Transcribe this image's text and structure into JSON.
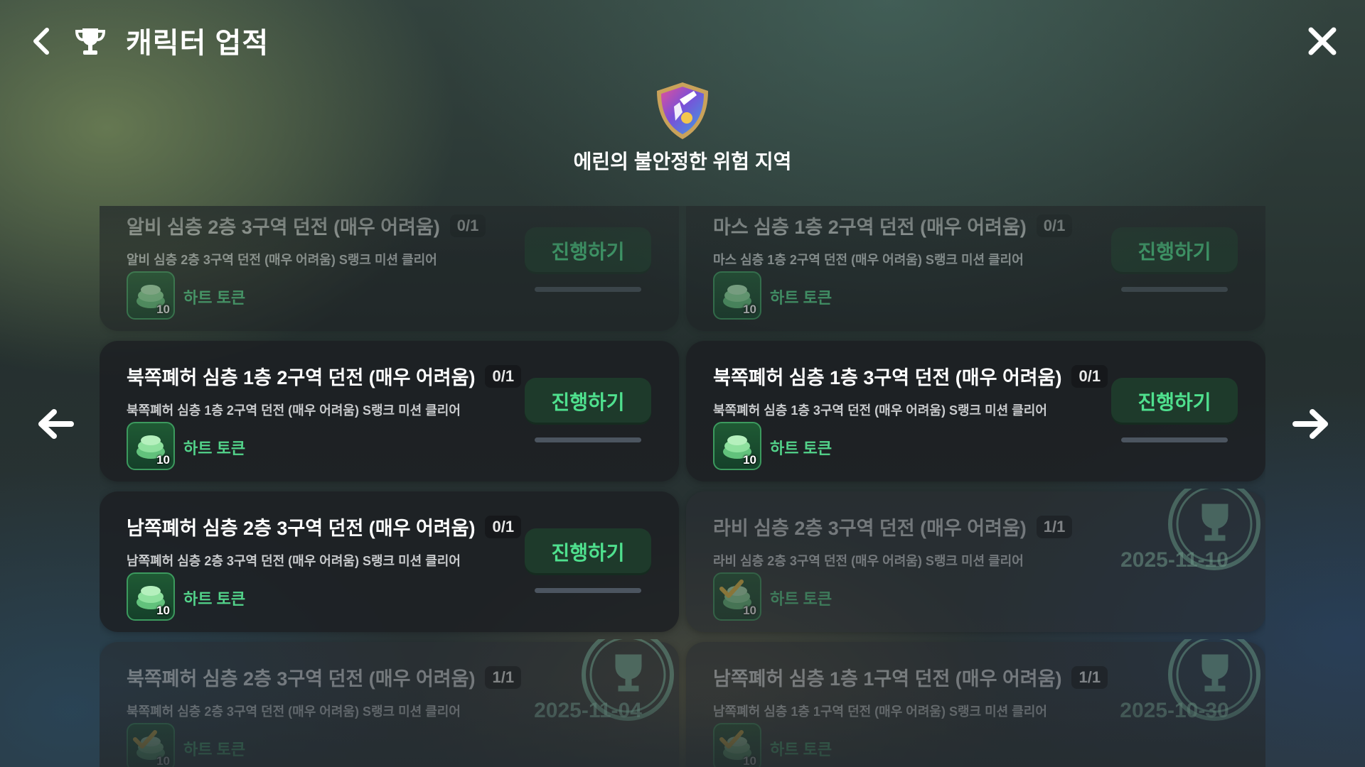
{
  "header": {
    "title": "캐릭터 업적",
    "back_icon": "chevron-left-icon",
    "trophy_icon": "trophy-icon",
    "close_icon": "close-icon"
  },
  "region": {
    "name": "에린의 불안정한 위험 지역",
    "emblem_icon": "shield-emblem-icon"
  },
  "colors": {
    "accent_green": "#4fe08e",
    "button_bg": "#1e3a2b",
    "card_bg": "#1c1e22",
    "track": "#4c5560"
  },
  "achievements": [
    {
      "title": "알비 심층 2층 3구역 던전 (매우 어려움)",
      "count": "0/1",
      "desc": "알비 심층 2층 3구역 던전 (매우 어려움) S랭크 미션 클리어",
      "reward_name": "하트 토큰",
      "reward_qty": "10",
      "button": "진행하기",
      "progress": 0,
      "completed": false,
      "date": ""
    },
    {
      "title": "마스 심층 1층 2구역 던전 (매우 어려움)",
      "count": "0/1",
      "desc": "마스 심층 1층 2구역 던전 (매우 어려움) S랭크 미션 클리어",
      "reward_name": "하트 토큰",
      "reward_qty": "10",
      "button": "진행하기",
      "progress": 0,
      "completed": false,
      "date": ""
    },
    {
      "title": "북쪽폐허 심층 1층 2구역 던전 (매우 어려움)",
      "count": "0/1",
      "desc": "북쪽폐허 심층 1층 2구역 던전 (매우 어려움) S랭크 미션 클리어",
      "reward_name": "하트 토큰",
      "reward_qty": "10",
      "button": "진행하기",
      "progress": 0,
      "completed": false,
      "date": ""
    },
    {
      "title": "북쪽폐허 심층 1층 3구역 던전 (매우 어려움)",
      "count": "0/1",
      "desc": "북쪽폐허 심층 1층 3구역 던전 (매우 어려움) S랭크 미션 클리어",
      "reward_name": "하트 토큰",
      "reward_qty": "10",
      "button": "진행하기",
      "progress": 0,
      "completed": false,
      "date": ""
    },
    {
      "title": "남쪽폐허 심층 2층 3구역 던전 (매우 어려움)",
      "count": "0/1",
      "desc": "남쪽폐허 심층 2층 3구역 던전 (매우 어려움) S랭크 미션 클리어",
      "reward_name": "하트 토큰",
      "reward_qty": "10",
      "button": "진행하기",
      "progress": 0,
      "completed": false,
      "date": ""
    },
    {
      "title": "라비 심층 2층 3구역 던전 (매우 어려움)",
      "count": "1/1",
      "desc": "라비 심층 2층 3구역 던전 (매우 어려움) S랭크 미션 클리어",
      "reward_name": "하트 토큰",
      "reward_qty": "10",
      "button": "",
      "progress": 1,
      "completed": true,
      "date": "2025-11-10"
    },
    {
      "title": "북쪽폐허 심층 2층 3구역 던전 (매우 어려움)",
      "count": "1/1",
      "desc": "북쪽폐허 심층 2층 3구역 던전 (매우 어려움) S랭크 미션 클리어",
      "reward_name": "하트 토큰",
      "reward_qty": "10",
      "button": "",
      "progress": 1,
      "completed": true,
      "date": "2025-11-04"
    },
    {
      "title": "남쪽폐허 심층 1층 1구역 던전 (매우 어려움)",
      "count": "1/1",
      "desc": "남쪽폐허 심층 1층 1구역 던전 (매우 어려움) S랭크 미션 클리어",
      "reward_name": "하트 토큰",
      "reward_qty": "10",
      "button": "",
      "progress": 1,
      "completed": true,
      "date": "2025-10-30"
    }
  ],
  "nav": {
    "prev_icon": "arrow-left-icon",
    "next_icon": "arrow-right-icon"
  }
}
